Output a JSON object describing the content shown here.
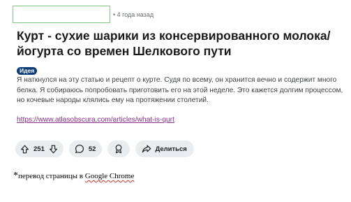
{
  "post": {
    "time_ago": "• 4 года назад",
    "title": "Курт - сухие шарики из консервированного молока/ йогурта со времен Шелкового пути",
    "flair": "Идея",
    "body": "Я наткнулся на эту статью и рецепт о курте. Судя по всему, он хранится вечно и содержит много белка. Я собираюсь попробовать приготовить его на этой неделе. Это кажется долгим процессом, но кочевые народы клялись ему на протяжении столетий.",
    "link": "https://www.atlasobscura.com/articles/what-is-qurt"
  },
  "actions": {
    "upvote_icon": "upvote-arrow-icon",
    "score": "251",
    "downvote_icon": "downvote-arrow-icon",
    "comment_icon": "speech-bubble-icon",
    "comments": "52",
    "award_icon": "award-ribbon-icon",
    "share_icon": "share-arrow-icon",
    "share_label": "Делиться"
  },
  "footnote": {
    "star": "*",
    "text_prefix": "перевод страницы в ",
    "text_brand": "Google Chrome"
  }
}
